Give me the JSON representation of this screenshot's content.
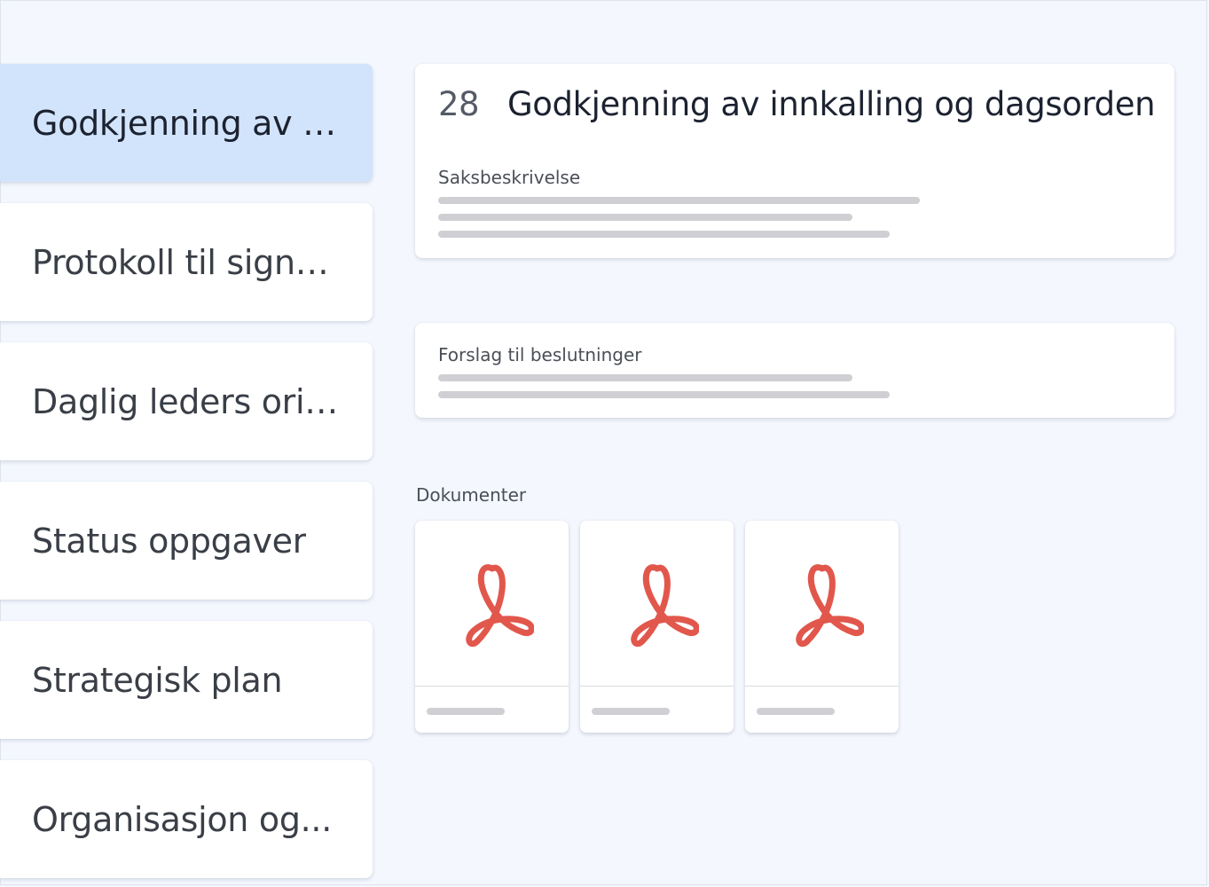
{
  "agenda": {
    "items": [
      {
        "label": "Godkjenning av i...",
        "active": true
      },
      {
        "label": "Protokoll til signa...",
        "active": false
      },
      {
        "label": "Daglig leders orie...",
        "active": false
      },
      {
        "label": "Status oppgaver",
        "active": false
      },
      {
        "label": "Strategisk plan",
        "active": false
      },
      {
        "label": "Organisasjon og...",
        "active": false
      }
    ]
  },
  "case": {
    "number": "28",
    "title": "Godkjenning av innkalling og dagsorden",
    "description_label": "Saksbeskrivelse"
  },
  "proposal": {
    "label": "Forslag til beslutninger"
  },
  "documents": {
    "heading": "Dokumenter",
    "files": [
      {
        "icon": "pdf-icon"
      },
      {
        "icon": "pdf-icon"
      },
      {
        "icon": "pdf-icon"
      }
    ]
  },
  "colors": {
    "background": "#f4f7fe",
    "active_item": "#d2e4fc",
    "pdf_red": "#e2574c",
    "placeholder": "#cfcfd4"
  }
}
